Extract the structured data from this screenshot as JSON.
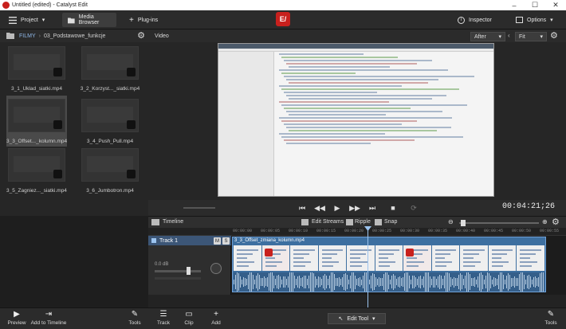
{
  "window": {
    "title": "Untitled (edited) - Catalyst Edit",
    "min": "–",
    "max": "☐",
    "close": "✕"
  },
  "toolbar": {
    "project": "Project",
    "media_browser": "Media Browser",
    "plugins": "Plug-ins",
    "logo": "E/",
    "inspector": "Inspector",
    "options": "Options"
  },
  "media_panel": {
    "breadcrumb": [
      "FILMY",
      "03_Podstawowe_funkcje"
    ],
    "items": [
      {
        "label": "3_1_Uklad_siatki.mp4",
        "selected": false
      },
      {
        "label": "3_2_Korzyst..._siatki.mp4",
        "selected": false
      },
      {
        "label": "3_3_Offset..._kolumn.mp4",
        "selected": true
      },
      {
        "label": "3_4_Push_Pull.mp4",
        "selected": false
      },
      {
        "label": "3_5_Zagniez..._siatki.mp4",
        "selected": false
      },
      {
        "label": "3_6_Jumbotron.mp4",
        "selected": false
      }
    ]
  },
  "viewer": {
    "label": "Video",
    "after": "After",
    "fit": "Fit"
  },
  "transport": {
    "timecode": "00:04:21;26"
  },
  "timeline": {
    "label": "Timeline",
    "edit_streams": "Edit Streams",
    "ripple": "Ripple",
    "snap": "Snap",
    "ruler": [
      "00:00:00",
      "00:00:05",
      "00:00:10",
      "00:00:15",
      "00:00:20",
      "00:00:25",
      "00:00:30",
      "00:00:35",
      "00:00:40",
      "00:00:45",
      "00:00:50",
      "00:00:55"
    ],
    "track": {
      "name": "Track 1",
      "m": "M",
      "s": "S",
      "volume": "0.0 dB"
    },
    "clip_name": "3_3_Offset_zmiana_kolumn.mp4"
  },
  "bottombar": {
    "preview": "Preview",
    "add_to_timeline": "Add to Timeline",
    "tools_left": "Tools",
    "track": "Track",
    "clip": "Clip",
    "add": "Add",
    "edit_tool": "Edit Tool",
    "tools_right": "Tools"
  },
  "colors": {
    "accent": "#3d6fa0",
    "brand": "#c8201d",
    "track_header": "#3c5677"
  }
}
